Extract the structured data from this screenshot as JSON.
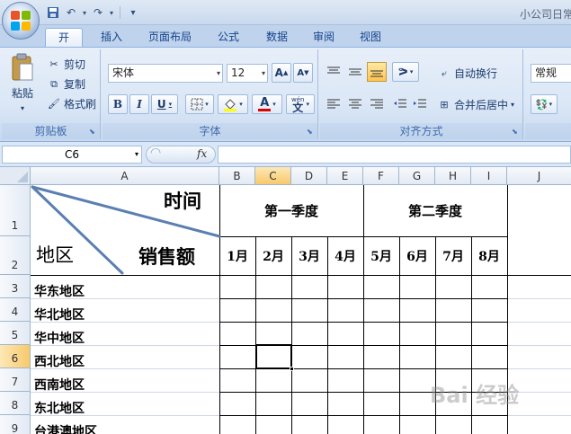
{
  "window": {
    "title": "小公司日常"
  },
  "quick_access": {
    "customize_glyph": "▾"
  },
  "tabs": [
    {
      "label": "开始",
      "active": true
    },
    {
      "label": "插入",
      "active": false
    },
    {
      "label": "页面布局",
      "active": false
    },
    {
      "label": "公式",
      "active": false
    },
    {
      "label": "数据",
      "active": false
    },
    {
      "label": "审阅",
      "active": false
    },
    {
      "label": "视图",
      "active": false
    }
  ],
  "ribbon": {
    "clipboard": {
      "label": "剪贴板",
      "paste": "粘贴",
      "cut": "剪切",
      "copy": "复制",
      "format_painter": "格式刷"
    },
    "font": {
      "label": "字体",
      "font_name": "宋体",
      "font_size": "12",
      "grow": "A",
      "shrink": "A",
      "bold": "B",
      "italic": "I",
      "underline": "U",
      "font_color_glyph": "A",
      "phonetic": "wén"
    },
    "alignment": {
      "label": "对齐方式",
      "wrap_text": "自动换行",
      "merge_center": "合并后居中"
    },
    "number": {
      "format": "常规"
    }
  },
  "formula_bar": {
    "name_box": "C6",
    "fx": "fx",
    "content": ""
  },
  "sheet": {
    "columns": [
      "A",
      "B",
      "C",
      "D",
      "E",
      "F",
      "G",
      "H",
      "I",
      "J"
    ],
    "selected_column": "C",
    "selected_row": "6",
    "rows": [
      "1",
      "2",
      "3",
      "4",
      "5",
      "6",
      "7",
      "8",
      "9"
    ],
    "header_time": "时间",
    "header_region": "地区",
    "header_sales": "销售额",
    "quarter1": "第一季度",
    "quarter2": "第二季度",
    "months": [
      "1月",
      "2月",
      "3月",
      "4月",
      "5月",
      "6月",
      "7月",
      "8月"
    ],
    "regions": [
      "华东地区",
      "华北地区",
      "华中地区",
      "西北地区",
      "西南地区",
      "东北地区",
      "台港澳地区"
    ]
  },
  "watermark": "Bai 经验"
}
